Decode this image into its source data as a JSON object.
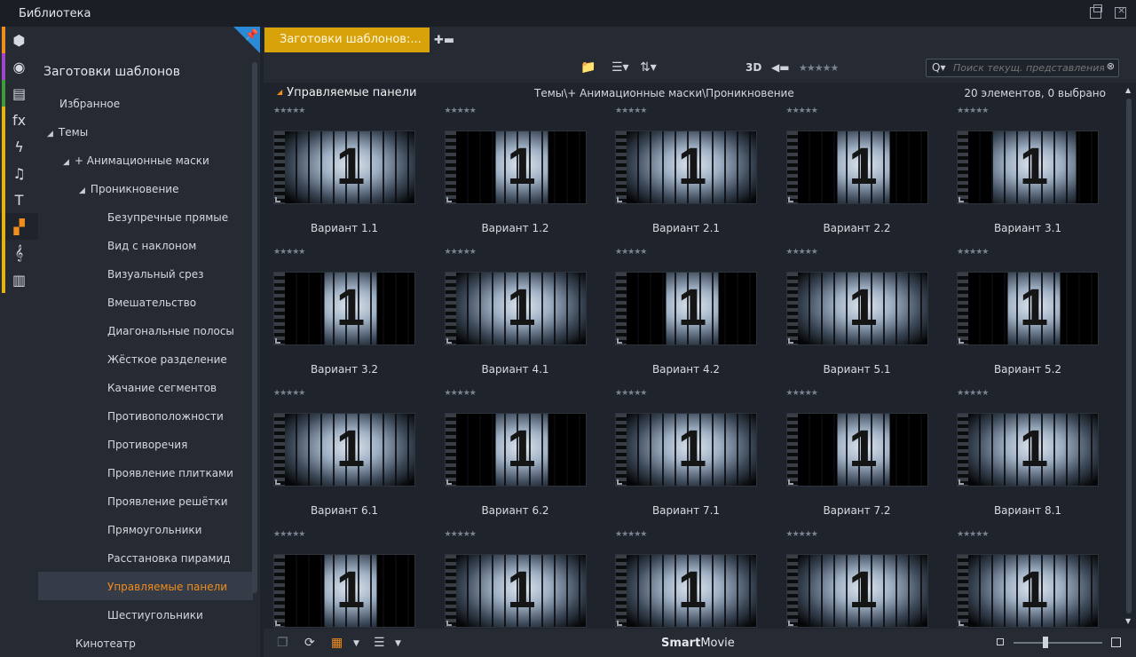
{
  "window": {
    "title": "Библиотека"
  },
  "iconbar": [
    {
      "icon": "project-box-icon",
      "glyph": "⬢",
      "color": "#f08d1c"
    },
    {
      "icon": "film-reel-icon",
      "glyph": "◉",
      "color": "#a045c8"
    },
    {
      "icon": "copy-stack-icon",
      "glyph": "▤",
      "color": "#3f9b3a"
    },
    {
      "icon": "fx-icon",
      "glyph": "fx",
      "color": "#e3b30f"
    },
    {
      "icon": "lightning-icon",
      "glyph": "ϟ",
      "color": "#e3b30f"
    },
    {
      "icon": "music-note-icon",
      "glyph": "♫",
      "color": "#e3b30f"
    },
    {
      "icon": "title-text-icon",
      "glyph": "T",
      "color": "#e3b30f"
    },
    {
      "icon": "blocks-icon",
      "glyph": "▞",
      "color": "#e3b30f"
    },
    {
      "icon": "treble-clef-icon",
      "glyph": "𝄞",
      "color": "#e3b30f"
    },
    {
      "icon": "piano-icon",
      "glyph": "▥",
      "color": "#e3b30f"
    }
  ],
  "tree": {
    "header": "Заготовки шаблонов",
    "nodes": [
      {
        "label": "Избранное",
        "depth": 0,
        "arrow": ""
      },
      {
        "label": "Темы",
        "depth": 0,
        "arrow": "◢"
      },
      {
        "label": "+ Анимационные маски",
        "depth": 1,
        "arrow": "◢"
      },
      {
        "label": "Проникновение",
        "depth": 2,
        "arrow": "◢"
      },
      {
        "label": "Безупречные прямые",
        "depth": 3,
        "arrow": ""
      },
      {
        "label": "Вид с наклоном",
        "depth": 3,
        "arrow": ""
      },
      {
        "label": "Визуальный срез",
        "depth": 3,
        "arrow": ""
      },
      {
        "label": "Вмешательство",
        "depth": 3,
        "arrow": ""
      },
      {
        "label": "Диагональные полосы",
        "depth": 3,
        "arrow": ""
      },
      {
        "label": "Жёсткое разделение",
        "depth": 3,
        "arrow": ""
      },
      {
        "label": "Качание сегментов",
        "depth": 3,
        "arrow": ""
      },
      {
        "label": "Противоположности",
        "depth": 3,
        "arrow": ""
      },
      {
        "label": "Противоречия",
        "depth": 3,
        "arrow": ""
      },
      {
        "label": "Проявление плитками",
        "depth": 3,
        "arrow": ""
      },
      {
        "label": "Проявление решётки",
        "depth": 3,
        "arrow": ""
      },
      {
        "label": "Прямоугольники",
        "depth": 3,
        "arrow": ""
      },
      {
        "label": "Расстановка пирамид",
        "depth": 3,
        "arrow": ""
      },
      {
        "label": "Управляемые панели",
        "depth": 3,
        "arrow": "",
        "selected": true
      },
      {
        "label": "Шестиугольники",
        "depth": 3,
        "arrow": ""
      },
      {
        "label": "Кинотеатр",
        "depth": 1,
        "arrow": ""
      }
    ]
  },
  "tab": {
    "label": "Заготовки шаблонов:..."
  },
  "toolbar": {
    "three_d": "3D",
    "rating": "★★★★★"
  },
  "search": {
    "placeholder": "Поиск текущ. представления"
  },
  "content": {
    "section": "Управляемые панели",
    "path": "Темы\\+ Анимационные маски\\Проникновение",
    "count": "20 элементов, 0 выбрано",
    "rating": "★★★★★",
    "items": [
      {
        "label": "Вариант 1.1",
        "style": "full"
      },
      {
        "label": "Вариант 1.2",
        "style": "narrow"
      },
      {
        "label": "Вариант 2.1",
        "style": "full"
      },
      {
        "label": "Вариант 2.2",
        "style": "narrow"
      },
      {
        "label": "Вариант 3.1",
        "style": "mid"
      },
      {
        "label": "Вариант 3.2",
        "style": "narrow"
      },
      {
        "label": "Вариант 4.1",
        "style": "full"
      },
      {
        "label": "Вариант 4.2",
        "style": "narrow"
      },
      {
        "label": "Вариант 5.1",
        "style": "full"
      },
      {
        "label": "Вариант 5.2",
        "style": "narrow"
      },
      {
        "label": "Вариант 6.1",
        "style": "full"
      },
      {
        "label": "Вариант 6.2",
        "style": "narrow"
      },
      {
        "label": "Вариант 7.1",
        "style": "full"
      },
      {
        "label": "Вариант 7.2",
        "style": "narrow"
      },
      {
        "label": "Вариант 8.1",
        "style": "full"
      },
      {
        "label": "",
        "style": "narrow"
      },
      {
        "label": "",
        "style": "full"
      },
      {
        "label": "",
        "style": "full"
      },
      {
        "label": "",
        "style": "full"
      },
      {
        "label": "",
        "style": "full"
      }
    ],
    "thumb_digit": "1"
  },
  "bottom": {
    "smart_bold": "Smart",
    "smart_rest": "Movie"
  }
}
